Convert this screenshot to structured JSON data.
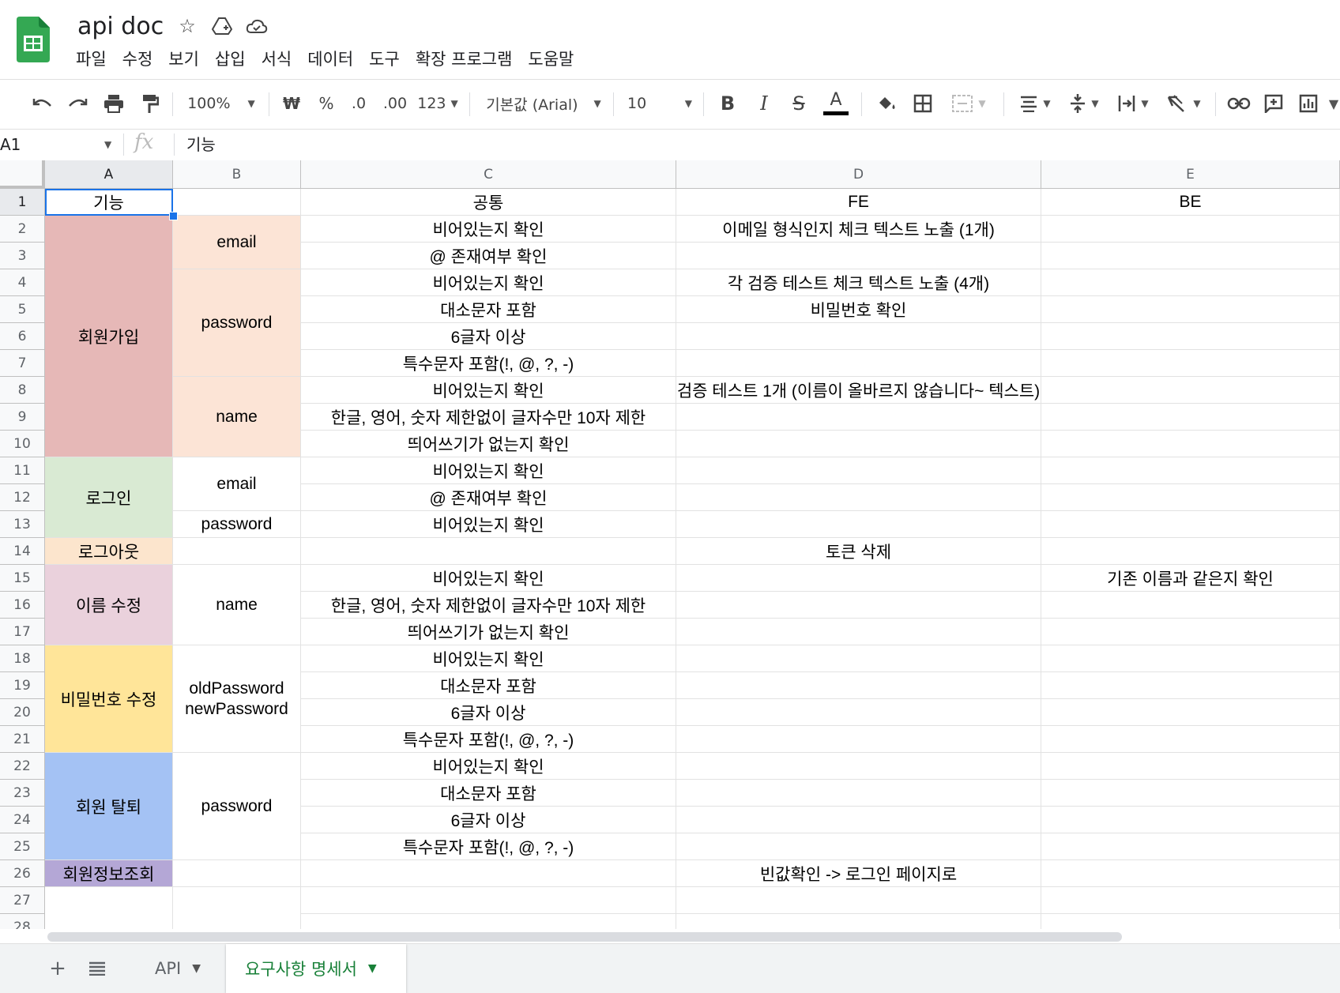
{
  "document": {
    "title": "api doc"
  },
  "menu": [
    "파일",
    "수정",
    "보기",
    "삽입",
    "서식",
    "데이터",
    "도구",
    "확장 프로그램",
    "도움말"
  ],
  "toolbar": {
    "zoom": "100%",
    "currency": "₩",
    "percent": "%",
    "dec_decrease": ".0",
    "dec_increase": ".00",
    "number_format": "123",
    "font": "기본값 (Arial)",
    "font_size": "10",
    "bold": "B",
    "italic": "I",
    "strike": "S",
    "text_color": "A"
  },
  "formula_bar": {
    "cell_ref": "A1",
    "fx": "fx",
    "content": "기능"
  },
  "columns": [
    "A",
    "B",
    "C",
    "D",
    "E"
  ],
  "rows": [
    "1",
    "2",
    "3",
    "4",
    "5",
    "6",
    "7",
    "8",
    "9",
    "10",
    "11",
    "12",
    "13",
    "14",
    "15",
    "16",
    "17",
    "18",
    "19",
    "20",
    "21",
    "22",
    "23",
    "24",
    "25",
    "26",
    "27",
    "28"
  ],
  "cells": {
    "a1": "기능",
    "c1": "공통",
    "d1": "FE",
    "e1": "BE",
    "a_signup": "회원가입",
    "a_login": "로그인",
    "a_logout": "로그아웃",
    "a_rename": "이름 수정",
    "a_pwchange": "비밀번호 수정",
    "a_withdraw": "회원 탈퇴",
    "a_info": "회원정보조회",
    "b_email1": "email",
    "b_password1": "password",
    "b_name1": "name",
    "b_email2": "email",
    "b_password2": "password",
    "b_name2": "name",
    "b_pwchange": "oldPassword newPassword",
    "b_password3": "password",
    "c2": "비어있는지 확인",
    "c3": "@ 존재여부 확인",
    "c4": "비어있는지 확인",
    "c5": "대소문자 포함",
    "c6": "6글자 이상",
    "c7": "특수문자 포함(!, @, ?, -)",
    "c8": "비어있는지 확인",
    "c9": "한글, 영어, 숫자 제한없이 글자수만 10자 제한",
    "c10": "띄어쓰기가 없는지 확인",
    "c11": "비어있는지 확인",
    "c12": "@ 존재여부 확인",
    "c13": "비어있는지 확인",
    "c15": "비어있는지 확인",
    "c16": "한글, 영어, 숫자 제한없이 글자수만 10자 제한",
    "c17": "띄어쓰기가 없는지 확인",
    "c18": "비어있는지 확인",
    "c19": "대소문자 포함",
    "c20": "6글자 이상",
    "c21": "특수문자 포함(!, @, ?, -)",
    "c22": "비어있는지 확인",
    "c23": "대소문자 포함",
    "c24": "6글자 이상",
    "c25": "특수문자 포함(!, @, ?, -)",
    "d2": "이메일 형식인지 체크 텍스트 노출 (1개)",
    "d4": "각 검증 테스트 체크 텍스트 노출 (4개)",
    "d5": "비밀번호 확인",
    "d8": "검증 테스트 1개 (이름이 올바르지 않습니다~ 텍스트)",
    "d14": "토큰 삭제",
    "d26": "빈값확인 -> 로그인 페이지로",
    "e15": "기존 이름과 같은지 확인"
  },
  "colors": {
    "signup": "#e6b8b7",
    "signup_b": "#fce4d6",
    "login": "#d9ead3",
    "logout": "#fce5cd",
    "rename": "#ead1dc",
    "pwchange": "#ffe599",
    "withdraw": "#a4c2f4",
    "info": "#b4a7d6",
    "accent": "#1a73e8",
    "sheet_active": "#188038"
  },
  "sheets": [
    {
      "label": "API"
    },
    {
      "label": "요구사항 명세서"
    }
  ]
}
